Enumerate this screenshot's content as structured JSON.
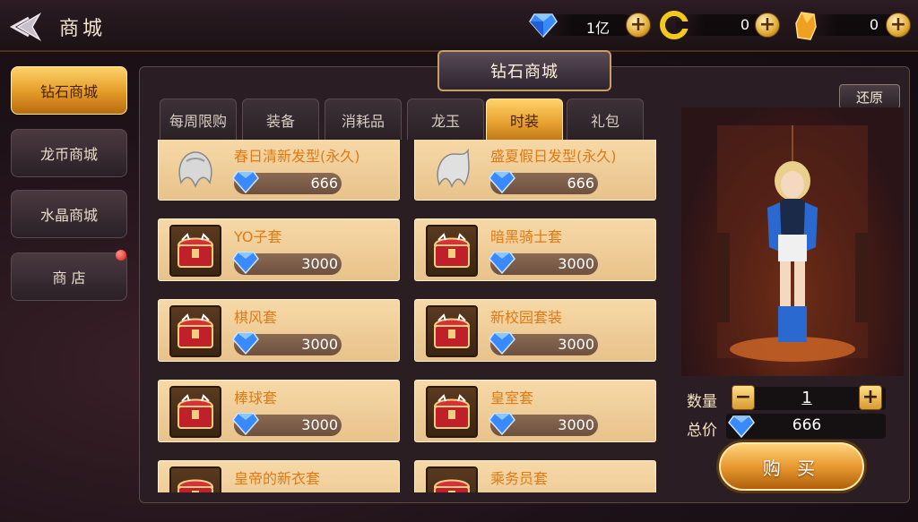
{
  "header": {
    "title": "商城",
    "currencies": [
      {
        "icon": "diamond-icon",
        "value": "1亿"
      },
      {
        "icon": "gold-coin-icon",
        "value": "0"
      },
      {
        "icon": "crystal-icon",
        "value": "0"
      }
    ]
  },
  "sidebar": {
    "items": [
      {
        "label": "钻石商城",
        "active": true
      },
      {
        "label": "龙币商城",
        "active": false
      },
      {
        "label": "水晶商城",
        "active": false
      },
      {
        "label": "商 店",
        "active": false,
        "badge": true
      }
    ]
  },
  "panel": {
    "title": "钻石商城",
    "restore_label": "还原",
    "tabs": [
      {
        "label": "每周限购",
        "active": false
      },
      {
        "label": "装备",
        "active": false
      },
      {
        "label": "消耗品",
        "active": false
      },
      {
        "label": "龙玉",
        "active": false
      },
      {
        "label": "时装",
        "active": true
      },
      {
        "label": "礼包",
        "active": false
      }
    ]
  },
  "items": [
    {
      "name": "春日清新发型(永久)",
      "price": "666",
      "thumb": "hair-icon"
    },
    {
      "name": "盛夏假日发型(永久)",
      "price": "666",
      "thumb": "hair-icon"
    },
    {
      "name": "YO子套",
      "price": "3000",
      "thumb": "treasure-chest-icon"
    },
    {
      "name": "暗黑骑士套",
      "price": "3000",
      "thumb": "treasure-chest-icon"
    },
    {
      "name": "棋风套",
      "price": "3000",
      "thumb": "treasure-chest-icon"
    },
    {
      "name": "新校园套装",
      "price": "3000",
      "thumb": "treasure-chest-icon"
    },
    {
      "name": "棒球套",
      "price": "3000",
      "thumb": "treasure-chest-icon"
    },
    {
      "name": "皇室套",
      "price": "3000",
      "thumb": "treasure-chest-icon"
    },
    {
      "name": "皇帝的新衣套",
      "price": "",
      "thumb": "treasure-chest-icon"
    },
    {
      "name": "乘务员套",
      "price": "",
      "thumb": "treasure-chest-icon"
    }
  ],
  "purchase": {
    "quantity_label": "数量",
    "quantity": "1",
    "total_label": "总价",
    "total": "666",
    "buy_label": "购 买"
  },
  "colors": {
    "accent": "#e6a030",
    "item_name": "#e07a14",
    "card_bg": "#f6d9a8"
  }
}
